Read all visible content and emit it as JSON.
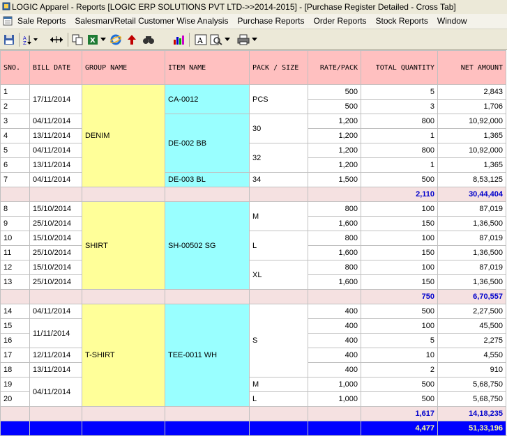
{
  "window": {
    "title": "LOGIC Apparel - Reports  [LOGIC ERP SOLUTIONS PVT LTD->>2014-2015] - [Purchase Register Detailed - Cross Tab]"
  },
  "menu": [
    "Sale Reports",
    "Salesman/Retail Customer Wise Analysis",
    "Purchase Reports",
    "Order Reports",
    "Stock Reports",
    "Window"
  ],
  "toolbar": {
    "icons": [
      "save-icon",
      "sort-icon",
      "resize-columns-icon",
      "copy-icon",
      "excel-icon",
      "ie-icon",
      "up-arrow-icon",
      "find-icon",
      "chart-icon",
      "font-icon",
      "print-preview-icon",
      "print-icon"
    ]
  },
  "table": {
    "headers": {
      "sno": "SNO.",
      "bill_date": "BILL DATE",
      "group_name": "GROUP NAME",
      "item_name": "ITEM NAME",
      "pack_size": "PACK / SIZE",
      "rate_pack": "RATE/PACK",
      "total_quantity": "TOTAL QUANTITY",
      "net_amount": "NET AMOUNT"
    },
    "groups": [
      {
        "group": "DENIM",
        "rows": [
          {
            "sno": "1",
            "date": "17/11/2014",
            "rate": "500",
            "qty": "5",
            "amount": "2,843"
          },
          {
            "sno": "2",
            "date": "",
            "rate": "500",
            "qty": "3",
            "amount": "1,706"
          },
          {
            "sno": "3",
            "date": "04/11/2014",
            "rate": "1,200",
            "qty": "800",
            "amount": "10,92,000"
          },
          {
            "sno": "4",
            "date": "13/11/2014",
            "rate": "1,200",
            "qty": "1",
            "amount": "1,365"
          },
          {
            "sno": "5",
            "date": "04/11/2014",
            "rate": "1,200",
            "qty": "800",
            "amount": "10,92,000"
          },
          {
            "sno": "6",
            "date": "13/11/2014",
            "rate": "1,200",
            "qty": "1",
            "amount": "1,365"
          },
          {
            "sno": "7",
            "date": "04/11/2014",
            "rate": "1,500",
            "qty": "500",
            "amount": "8,53,125"
          }
        ],
        "items": [
          "CA-0012",
          "DE-002 BB",
          "DE-003 BL"
        ],
        "sizes": [
          "PCS",
          "30",
          "32",
          "34"
        ],
        "subtotal": {
          "qty": "2,110",
          "amount": "30,44,404"
        }
      },
      {
        "group": "SHIRT",
        "rows": [
          {
            "sno": "8",
            "date": "15/10/2014",
            "rate": "800",
            "qty": "100",
            "amount": "87,019"
          },
          {
            "sno": "9",
            "date": "25/10/2014",
            "rate": "1,600",
            "qty": "150",
            "amount": "1,36,500"
          },
          {
            "sno": "10",
            "date": "15/10/2014",
            "rate": "800",
            "qty": "100",
            "amount": "87,019"
          },
          {
            "sno": "11",
            "date": "25/10/2014",
            "rate": "1,600",
            "qty": "150",
            "amount": "1,36,500"
          },
          {
            "sno": "12",
            "date": "15/10/2014",
            "rate": "800",
            "qty": "100",
            "amount": "87,019"
          },
          {
            "sno": "13",
            "date": "25/10/2014",
            "rate": "1,600",
            "qty": "150",
            "amount": "1,36,500"
          }
        ],
        "items": [
          "SH-00502 SG"
        ],
        "sizes": [
          "M",
          "L",
          "XL"
        ],
        "subtotal": {
          "qty": "750",
          "amount": "6,70,557"
        }
      },
      {
        "group": "T-SHIRT",
        "rows": [
          {
            "sno": "14",
            "date": "04/11/2014",
            "rate": "400",
            "qty": "500",
            "amount": "2,27,500"
          },
          {
            "sno": "15",
            "date": "11/11/2014",
            "rate": "400",
            "qty": "100",
            "amount": "45,500"
          },
          {
            "sno": "16",
            "date": "",
            "rate": "400",
            "qty": "5",
            "amount": "2,275"
          },
          {
            "sno": "17",
            "date": "12/11/2014",
            "rate": "400",
            "qty": "10",
            "amount": "4,550"
          },
          {
            "sno": "18",
            "date": "13/11/2014",
            "rate": "400",
            "qty": "2",
            "amount": "910"
          },
          {
            "sno": "19",
            "date": "04/11/2014",
            "rate": "1,000",
            "qty": "500",
            "amount": "5,68,750"
          },
          {
            "sno": "20",
            "date": "",
            "rate": "1,000",
            "qty": "500",
            "amount": "5,68,750"
          }
        ],
        "items": [
          "TEE-0011 WH"
        ],
        "sizes": [
          "S",
          "M",
          "L"
        ],
        "subtotal": {
          "qty": "1,617",
          "amount": "14,18,235"
        }
      }
    ],
    "grand_total": {
      "qty": "4,477",
      "amount": "51,33,196"
    }
  }
}
